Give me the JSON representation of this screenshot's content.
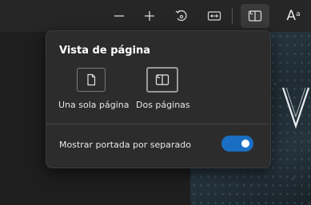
{
  "toolbar": {
    "zoom_out_icon": "minus-icon",
    "zoom_in_icon": "plus-icon",
    "rotate_icon": "rotate-icon",
    "fit_icon": "fit-width-icon",
    "page_view_icon": "page-view-icon",
    "text_size_label": "A",
    "text_size_sup": "a"
  },
  "page_view_popup": {
    "title": "Vista de página",
    "options": [
      {
        "label": "Una sola página",
        "icon": "single-page-icon",
        "selected": false
      },
      {
        "label": "Dos páginas",
        "icon": "two-pages-icon",
        "selected": true
      }
    ],
    "toggle": {
      "label": "Mostrar portada por separado",
      "on": true,
      "color": "#1a6fc4"
    }
  },
  "colors": {
    "background": "#1c1c1c",
    "popup": "#2c2c2c",
    "accent": "#1a6fc4"
  }
}
